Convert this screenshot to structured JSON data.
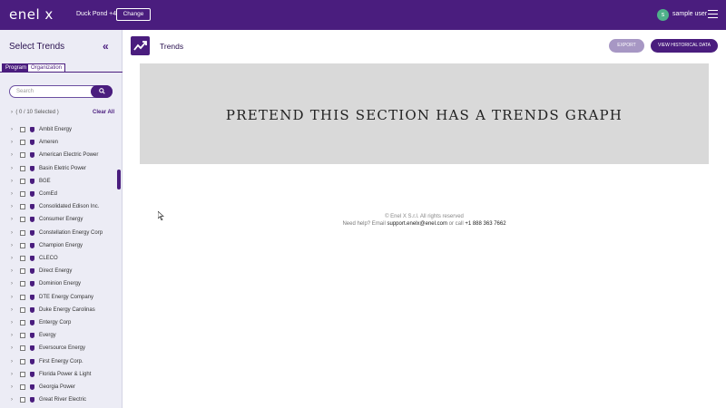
{
  "header": {
    "logo": "enel x",
    "site": "Duck Pond +4",
    "change_label": "Change",
    "avatar_initial": "s",
    "user": "sample user"
  },
  "sidebar": {
    "title": "Select Trends",
    "tabs": [
      "Program",
      "Organization"
    ],
    "search_placeholder": "Search",
    "selected_count": "( 0 / 10 Selected )",
    "clear_all": "Clear All",
    "items": [
      "Ambit Energy",
      "Ameren",
      "American Electric Power",
      "Basin Eletric Power",
      "BGE",
      "ComEd",
      "Consolidated Edison Inc.",
      "Consumer Energy",
      "Constellation Energy Corp",
      "Champion Energy",
      "CLECO",
      "Direct Energy",
      "Dominion Energy",
      "DTE Energy Company",
      "Duke Energy Carolinas",
      "Entergy Corp",
      "Evergy",
      "Eversource Energy",
      "First Energy Corp.",
      "Florida Power & Light",
      "Georgia Power",
      "Great River Electric"
    ]
  },
  "main": {
    "title": "Trends",
    "export_label": "EXPORT",
    "historical_label": "VIEW HISTORICAL DATA",
    "graph_placeholder": "PRETEND THIS SECTION HAS A TRENDS GRAPH"
  },
  "footer": {
    "copyright": "© Enel X S.r.l. All rights reserved",
    "help_prefix": "Need help? Email",
    "email": "support.enelx@enel.com",
    "or_call": "or call",
    "phone": "+1 888 363 7662"
  },
  "colors": {
    "brand": "#4a1d7e",
    "sidebar_bg": "#ececf5",
    "graph_bg": "#d9d9d9"
  },
  "icons": [
    "hamburger-menu-icon",
    "collapse-double-chevron-icon",
    "search-icon",
    "trend-line-icon",
    "shield-icon",
    "chevron-right-icon"
  ]
}
